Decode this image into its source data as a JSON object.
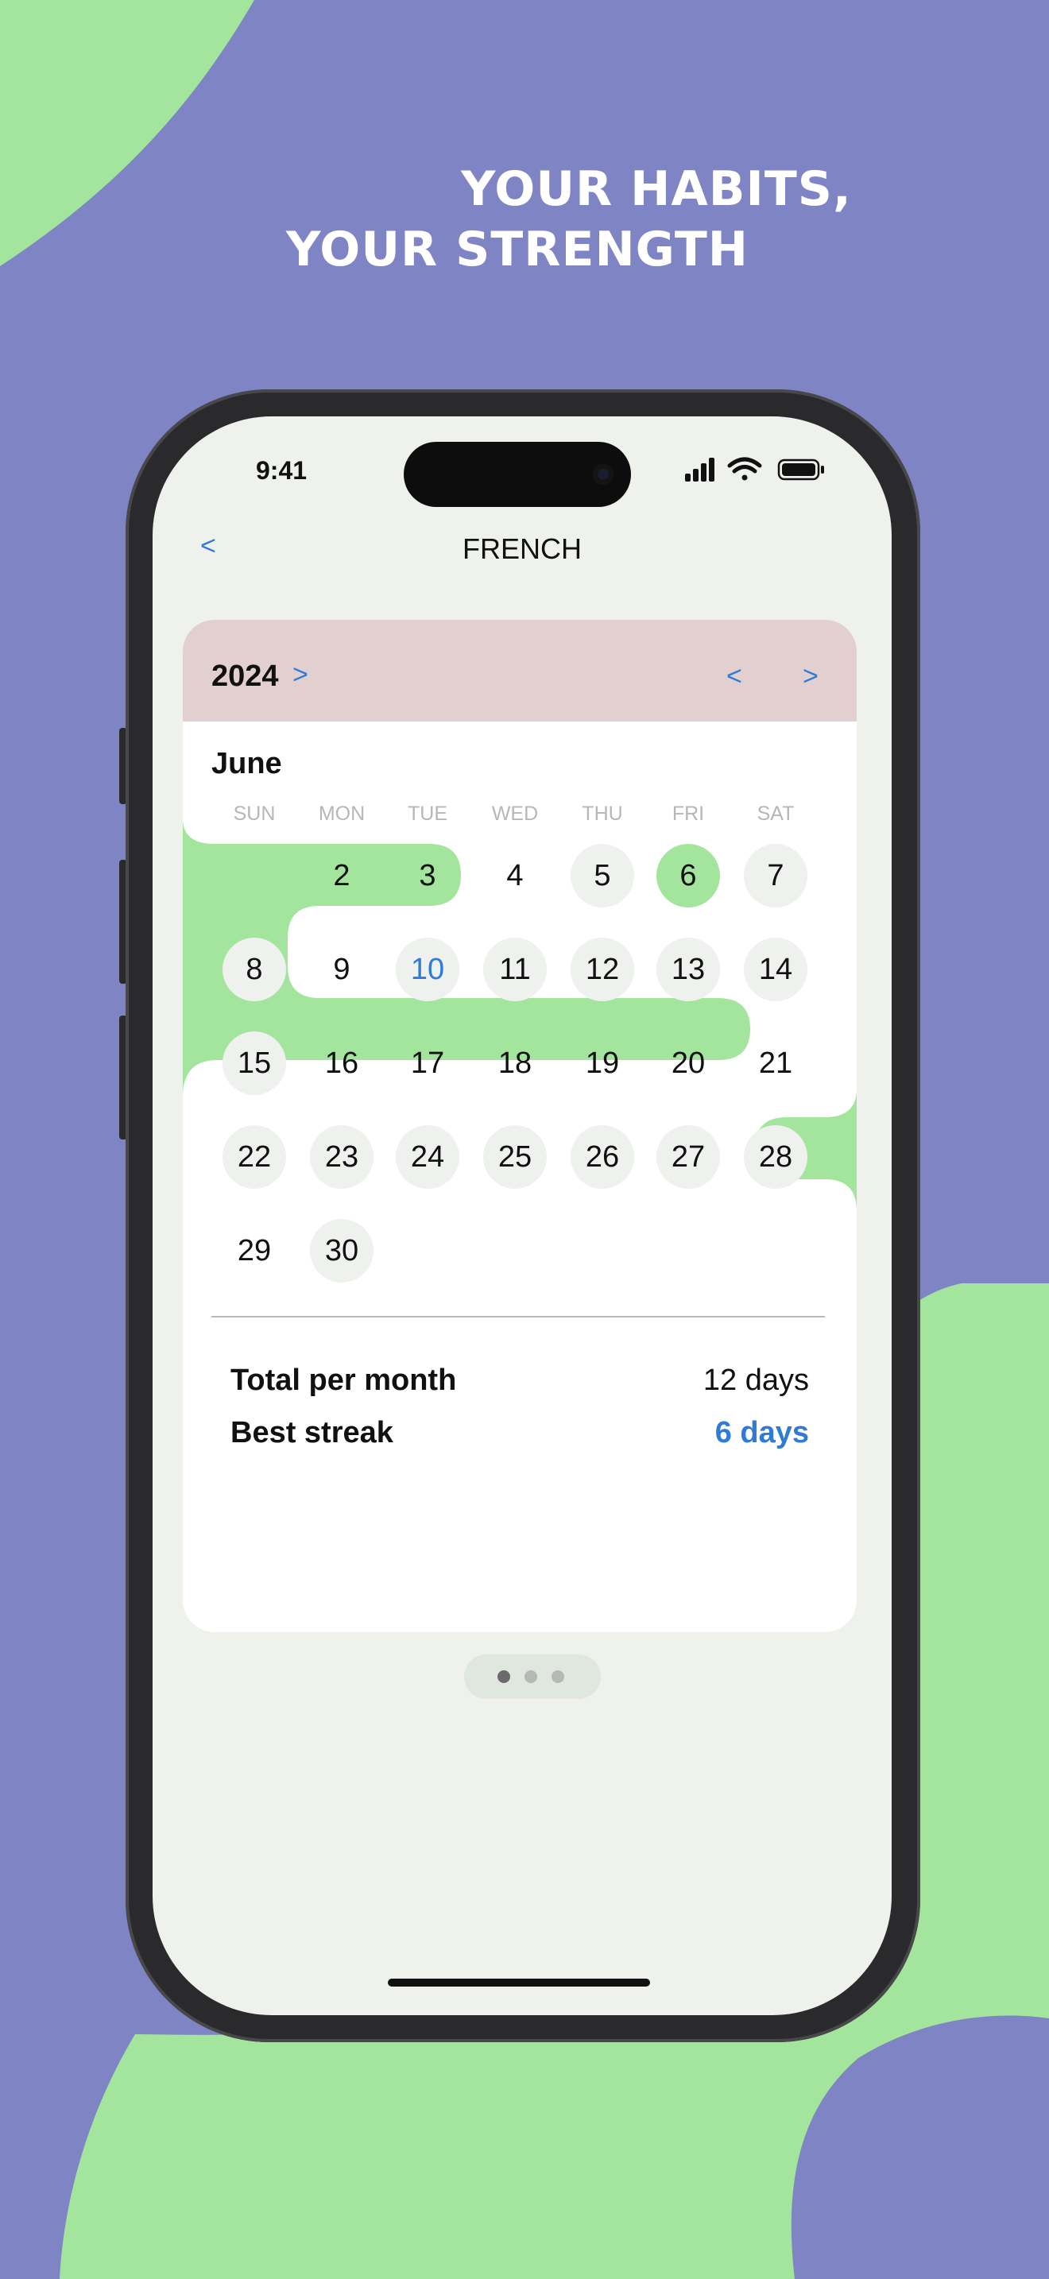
{
  "marketing": {
    "headline_line1": "YOUR HABITS,",
    "headline_line2": "YOUR STRENGTH"
  },
  "status_bar": {
    "time": "9:41"
  },
  "nav": {
    "back_label": "<",
    "title": "FRENCH"
  },
  "calendar": {
    "year": "2024",
    "year_next_label": ">",
    "month_prev_label": "<",
    "month_next_label": ">",
    "month": "June",
    "weekdays": [
      "SUN",
      "MON",
      "TUE",
      "WED",
      "THU",
      "FRI",
      "SAT"
    ],
    "days": [
      {
        "label": "2",
        "state": "streak"
      },
      {
        "label": "3",
        "state": "streak"
      },
      {
        "label": "4",
        "state": "streak"
      },
      {
        "label": "5",
        "state": "none"
      },
      {
        "label": "6",
        "state": "done"
      },
      {
        "label": "7",
        "state": "none"
      },
      {
        "label": "8",
        "state": "none"
      },
      {
        "label": "9",
        "state": "streak"
      },
      {
        "label": "10",
        "state": "today"
      },
      {
        "label": "11",
        "state": "none"
      },
      {
        "label": "12",
        "state": "none"
      },
      {
        "label": "13",
        "state": "none"
      },
      {
        "label": "14",
        "state": "none"
      },
      {
        "label": "15",
        "state": "none"
      },
      {
        "label": "16",
        "state": "streak"
      },
      {
        "label": "17",
        "state": "streak"
      },
      {
        "label": "18",
        "state": "streak"
      },
      {
        "label": "19",
        "state": "streak"
      },
      {
        "label": "20",
        "state": "streak"
      },
      {
        "label": "21",
        "state": "streak"
      },
      {
        "label": "22",
        "state": "none"
      },
      {
        "label": "23",
        "state": "none"
      },
      {
        "label": "24",
        "state": "none"
      },
      {
        "label": "25",
        "state": "none"
      },
      {
        "label": "26",
        "state": "none"
      },
      {
        "label": "27",
        "state": "none"
      },
      {
        "label": "28",
        "state": "none"
      },
      {
        "label": "29",
        "state": "streak"
      },
      {
        "label": "30",
        "state": "none"
      }
    ]
  },
  "stats": {
    "total_label": "Total per month",
    "total_value": "12 days",
    "streak_label": "Best streak",
    "streak_value": "6 days"
  },
  "pager": {
    "current_page": 1,
    "page_count": 3
  },
  "colors": {
    "background": "#7f84c4",
    "accent_green": "#a3e59c",
    "accent_blue": "#2f7bd6",
    "header_pink": "#e2cfcf",
    "screen_bg": "#eef1ec"
  }
}
